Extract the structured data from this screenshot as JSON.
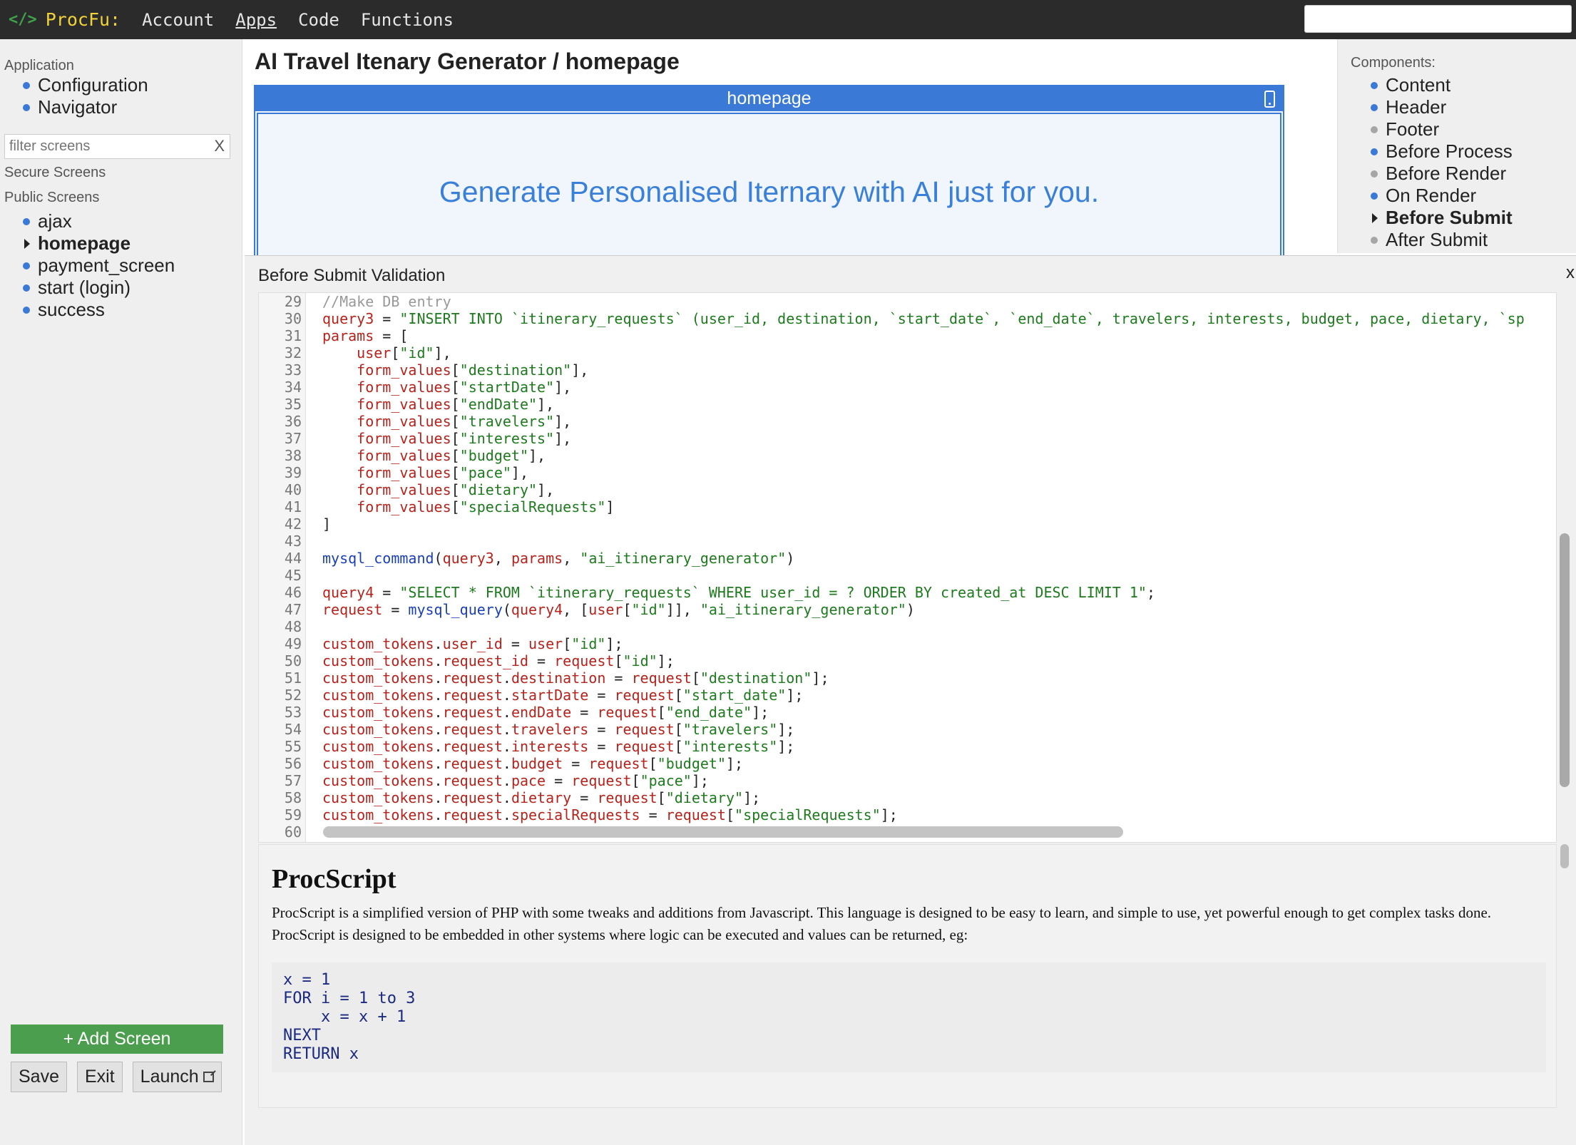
{
  "topbar": {
    "brand_icon": "</>",
    "brand": "ProcFu:",
    "nav": [
      "Account",
      "Apps",
      "Code",
      "Functions"
    ],
    "active_nav": "Apps",
    "search_value": ""
  },
  "sidebar": {
    "application_heading": "Application",
    "application_items": [
      "Configuration",
      "Navigator"
    ],
    "filter_placeholder": "filter screens",
    "filter_clear": "X",
    "secure_heading": "Secure Screens",
    "public_heading": "Public Screens",
    "public_items": [
      "ajax",
      "homepage",
      "payment_screen",
      "start (login)",
      "success"
    ],
    "selected_item": "homepage",
    "add_screen_label": "+ Add Screen",
    "save_label": "Save",
    "exit_label": "Exit",
    "launch_label": "Launch"
  },
  "main": {
    "title": "AI Travel Itenary Generator / homepage",
    "preview_header": "homepage",
    "preview_heading": "Generate Personalised Iternary with AI just for you."
  },
  "components": {
    "heading": "Components:",
    "items": [
      {
        "label": "Content",
        "status": "active"
      },
      {
        "label": "Header",
        "status": "active"
      },
      {
        "label": "Footer",
        "status": "inactive"
      },
      {
        "label": "Before Process",
        "status": "active"
      },
      {
        "label": "Before Render",
        "status": "inactive"
      },
      {
        "label": "On Render",
        "status": "active"
      },
      {
        "label": "Before Submit",
        "status": "selected"
      },
      {
        "label": "After Submit",
        "status": "inactive"
      }
    ]
  },
  "editor": {
    "title": "Before Submit Validation",
    "close_label": "x",
    "lines": [
      {
        "n": "29",
        "code": "//Make DB entry"
      },
      {
        "n": "30",
        "code": "query3 = \"INSERT INTO `itinerary_requests` (user_id, destination, `start_date`, `end_date`, travelers, interests, budget, pace, dietary, `sp"
      },
      {
        "n": "31",
        "code": "params = ["
      },
      {
        "n": "32",
        "code": "    user[\"id\"],"
      },
      {
        "n": "33",
        "code": "    form_values[\"destination\"],"
      },
      {
        "n": "34",
        "code": "    form_values[\"startDate\"],"
      },
      {
        "n": "35",
        "code": "    form_values[\"endDate\"],"
      },
      {
        "n": "36",
        "code": "    form_values[\"travelers\"],"
      },
      {
        "n": "37",
        "code": "    form_values[\"interests\"],"
      },
      {
        "n": "38",
        "code": "    form_values[\"budget\"],"
      },
      {
        "n": "39",
        "code": "    form_values[\"pace\"],"
      },
      {
        "n": "40",
        "code": "    form_values[\"dietary\"],"
      },
      {
        "n": "41",
        "code": "    form_values[\"specialRequests\"]"
      },
      {
        "n": "42",
        "code": "]"
      },
      {
        "n": "43",
        "code": ""
      },
      {
        "n": "44",
        "code": "mysql_command(query3, params, \"ai_itinerary_generator\")"
      },
      {
        "n": "45",
        "code": ""
      },
      {
        "n": "46",
        "code": "query4 = \"SELECT * FROM `itinerary_requests` WHERE user_id = ? ORDER BY created_at DESC LIMIT 1\";"
      },
      {
        "n": "47",
        "code": "request = mysql_query(query4, [user[\"id\"]], \"ai_itinerary_generator\")"
      },
      {
        "n": "48",
        "code": ""
      },
      {
        "n": "49",
        "code": "custom_tokens.user_id = user[\"id\"];"
      },
      {
        "n": "50",
        "code": "custom_tokens.request_id = request[\"id\"];"
      },
      {
        "n": "51",
        "code": "custom_tokens.request.destination = request[\"destination\"];"
      },
      {
        "n": "52",
        "code": "custom_tokens.request.startDate = request[\"start_date\"];"
      },
      {
        "n": "53",
        "code": "custom_tokens.request.endDate = request[\"end_date\"];"
      },
      {
        "n": "54",
        "code": "custom_tokens.request.travelers = request[\"travelers\"];"
      },
      {
        "n": "55",
        "code": "custom_tokens.request.interests = request[\"interests\"];"
      },
      {
        "n": "56",
        "code": "custom_tokens.request.budget = request[\"budget\"];"
      },
      {
        "n": "57",
        "code": "custom_tokens.request.pace = request[\"pace\"];"
      },
      {
        "n": "58",
        "code": "custom_tokens.request.dietary = request[\"dietary\"];"
      },
      {
        "n": "59",
        "code": "custom_tokens.request.specialRequests = request[\"specialRequests\"];"
      },
      {
        "n": "60",
        "code": ""
      }
    ]
  },
  "docs": {
    "title": "ProcScript",
    "para1": "ProcScript is a simplified version of PHP with some tweaks and additions from Javascript. This language is designed to be easy to learn, and simple to use, yet powerful enough to get complex tasks done.",
    "para2": "ProcScript is designed to be embedded in other systems where logic can be executed and values can be returned, eg:",
    "example": "x = 1\nFOR i = 1 to 3\n    x = x + 1\nNEXT\nRETURN x"
  },
  "colors": {
    "accent": "#3a79d5",
    "add_button": "#4c9e4f",
    "brand_text": "#f0d33a",
    "topbar_bg": "#2b2b2b"
  }
}
